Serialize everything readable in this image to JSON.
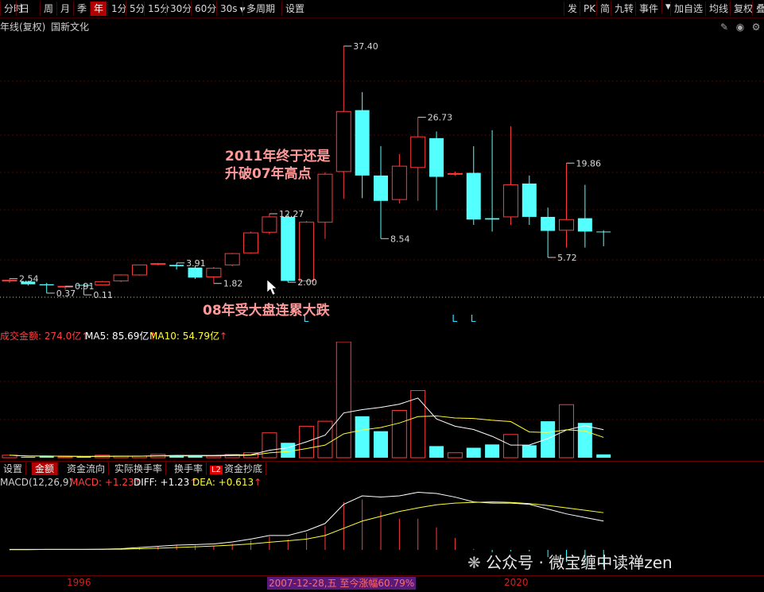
{
  "toolbar": {
    "left_items": [
      "分时",
      "日",
      "周",
      "月",
      "季",
      "年",
      "1分",
      "5分",
      "15分",
      "30分",
      "60分",
      "30s",
      "多周期",
      "设置"
    ],
    "active": "年",
    "right_items": [
      "发",
      "PK",
      "简",
      "九转",
      "事件",
      "加自选",
      "均线",
      "复权",
      "叠"
    ]
  },
  "header": {
    "period_label": "年线(复权)",
    "stock_name": "国新文化"
  },
  "annotations": {
    "top": [
      "2011年终于还是",
      "升破07年高点"
    ],
    "bottom": "08年受大盘连累大跌"
  },
  "price_labels": [
    "2.54",
    "0.37",
    "0.91",
    "0.11",
    "3.91",
    "1.82",
    "12.27",
    "2.00",
    "37.40",
    "8.54",
    "26.73",
    "19.86",
    "5.72"
  ],
  "volume_info": {
    "label": "成交金额: 274.0亿",
    "ma5": "MA5: 85.69亿",
    "ma10": "MA10: 54.79亿"
  },
  "tabs": [
    "设置",
    "金额",
    "资金流向",
    "实际换手率",
    "换手率",
    "资金抄底"
  ],
  "tab_active": "金额",
  "tab_l2_badge": "L2",
  "macd_info": {
    "label": "MACD(12,26,9)",
    "macd": "MACD: +1.23",
    "diff": "DIFF: +1.23",
    "dea": "DEA: +0.613"
  },
  "axis": {
    "year_1": "1996",
    "status": "2007-12-28,五 至今涨幅60.79%",
    "year_2": "2020"
  },
  "markers": [
    "L",
    "L",
    "L"
  ],
  "watermark": "公众号 · 微宝缠中读禅zen",
  "colors": {
    "up": "#ff3b3b",
    "down": "#54ffff",
    "ma5": "#ffffff",
    "ma10": "#ffff33",
    "bg": "#000000"
  },
  "chart_data": {
    "type": "candlestick",
    "candles": [
      {
        "o": 2.2,
        "h": 2.54,
        "l": 1.9,
        "c": 2.3,
        "up": true
      },
      {
        "o": 2.1,
        "h": 2.2,
        "l": 1.5,
        "c": 1.7,
        "up": false
      },
      {
        "o": 1.7,
        "h": 1.9,
        "l": 0.37,
        "c": 1.55,
        "up": false
      },
      {
        "o": 1.3,
        "h": 1.4,
        "l": 0.91,
        "c": 1.4,
        "up": true
      },
      {
        "o": 1.6,
        "h": 1.8,
        "l": 0.11,
        "c": 1.5,
        "up": false
      },
      {
        "o": 1.6,
        "h": 2.2,
        "l": 1.5,
        "c": 2.1,
        "up": true
      },
      {
        "o": 2.2,
        "h": 3.2,
        "l": 2.0,
        "c": 3.1,
        "up": true
      },
      {
        "o": 3.1,
        "h": 4.6,
        "l": 3.0,
        "c": 4.6,
        "up": true
      },
      {
        "o": 4.7,
        "h": 4.9,
        "l": 4.5,
        "c": 4.8,
        "up": true
      },
      {
        "o": 4.6,
        "h": 4.9,
        "l": 3.91,
        "c": 4.4,
        "up": false
      },
      {
        "o": 4.2,
        "h": 4.5,
        "l": 2.5,
        "c": 2.7,
        "up": false
      },
      {
        "o": 2.8,
        "h": 4.3,
        "l": 1.82,
        "c": 4.1,
        "up": true
      },
      {
        "o": 4.6,
        "h": 6.4,
        "l": 4.4,
        "c": 6.3,
        "up": true
      },
      {
        "o": 6.4,
        "h": 9.6,
        "l": 6.3,
        "c": 9.4,
        "up": true
      },
      {
        "o": 9.5,
        "h": 12.27,
        "l": 9.2,
        "c": 11.8,
        "up": true
      },
      {
        "o": 11.8,
        "h": 12.27,
        "l": 2.0,
        "c": 2.2,
        "up": false
      },
      {
        "o": 2.2,
        "h": 11.2,
        "l": 2.0,
        "c": 11.0,
        "up": true
      },
      {
        "o": 11.0,
        "h": 18.5,
        "l": 8.5,
        "c": 18.2,
        "up": true
      },
      {
        "o": 18.6,
        "h": 37.4,
        "l": 14.5,
        "c": 27.6,
        "up": true
      },
      {
        "o": 27.8,
        "h": 30.5,
        "l": 14.6,
        "c": 18.0,
        "up": false
      },
      {
        "o": 18.0,
        "h": 22.4,
        "l": 8.54,
        "c": 14.2,
        "up": false
      },
      {
        "o": 14.4,
        "h": 21.2,
        "l": 13.8,
        "c": 19.4,
        "up": true
      },
      {
        "o": 19.2,
        "h": 26.73,
        "l": 14.2,
        "c": 23.8,
        "up": true
      },
      {
        "o": 23.6,
        "h": 24.6,
        "l": 12.8,
        "c": 17.8,
        "up": false
      },
      {
        "o": 18.3,
        "h": 18.6,
        "l": 18.0,
        "c": 18.3,
        "up": true
      },
      {
        "o": 18.4,
        "h": 22.4,
        "l": 10.6,
        "c": 11.4,
        "up": false
      },
      {
        "o": 11.4,
        "h": 24.8,
        "l": 9.6,
        "c": 11.6,
        "up": false
      },
      {
        "o": 11.8,
        "h": 25.4,
        "l": 10.6,
        "c": 16.6,
        "up": true
      },
      {
        "o": 16.8,
        "h": 18.0,
        "l": 10.6,
        "c": 11.8,
        "up": false
      },
      {
        "o": 11.8,
        "h": 13.2,
        "l": 5.72,
        "c": 9.7,
        "up": false
      },
      {
        "o": 9.8,
        "h": 19.86,
        "l": 7.2,
        "c": 11.4,
        "up": true
      },
      {
        "o": 11.6,
        "h": 16.6,
        "l": 7.2,
        "c": 9.6,
        "up": false
      },
      {
        "o": 9.6,
        "h": 9.8,
        "l": 7.4,
        "c": 9.6,
        "up": false
      }
    ],
    "volume": [
      3,
      1,
      2,
      1,
      1,
      3,
      2,
      2,
      4,
      3,
      3,
      2,
      4,
      6,
      30,
      18,
      38,
      44,
      140,
      50,
      32,
      57,
      81,
      14,
      6,
      12,
      16,
      28,
      15,
      44,
      64,
      42,
      4
    ],
    "macd_diff": [
      0.02,
      0.02,
      0.02,
      0.02,
      0.02,
      0.03,
      0.05,
      0.1,
      0.15,
      0.2,
      0.22,
      0.25,
      0.33,
      0.45,
      0.6,
      0.6,
      0.8,
      1.1,
      1.9,
      2.25,
      2.2,
      2.25,
      2.4,
      2.35,
      2.2,
      2.0,
      1.95,
      1.95,
      1.9,
      1.7,
      1.5,
      1.35,
      1.2
    ],
    "macd_dea": [
      0.01,
      0.01,
      0.02,
      0.02,
      0.02,
      0.02,
      0.03,
      0.05,
      0.07,
      0.1,
      0.13,
      0.16,
      0.2,
      0.25,
      0.32,
      0.38,
      0.45,
      0.6,
      0.9,
      1.2,
      1.4,
      1.6,
      1.75,
      1.88,
      1.95,
      1.98,
      2.0,
      1.98,
      1.93,
      1.85,
      1.75,
      1.65,
      1.55
    ],
    "ylabel": "",
    "xlabel": ""
  }
}
